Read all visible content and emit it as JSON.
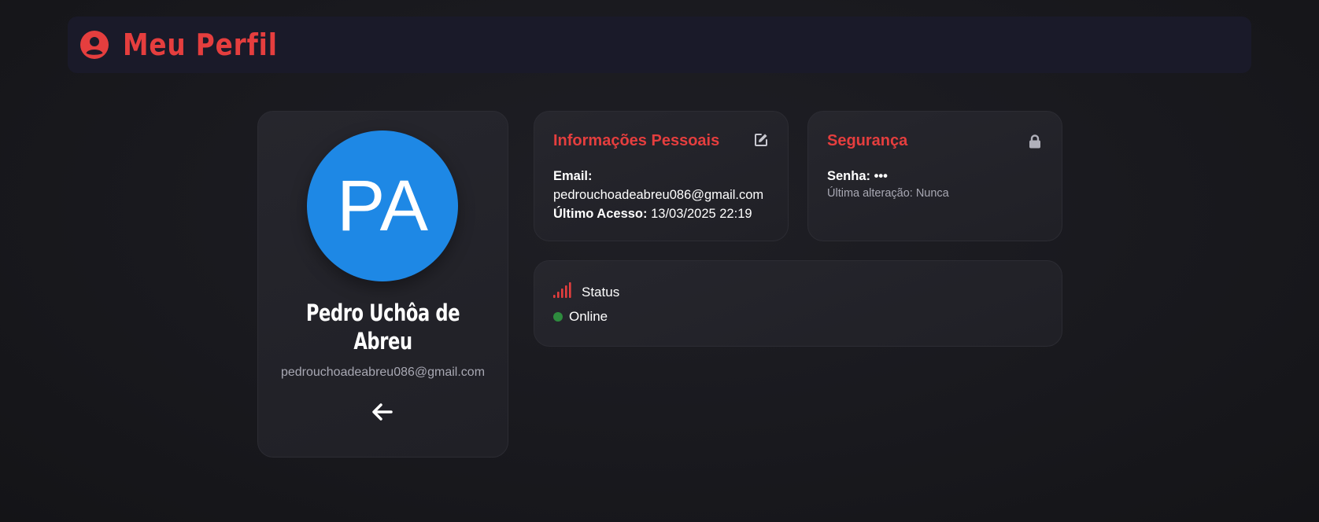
{
  "header": {
    "title": "Meu Perfil",
    "icon": "user-circle-icon"
  },
  "profile": {
    "initials": "PA",
    "name": "Pedro Uchôa de Abreu",
    "email": "pedrouchoadeabreu086@gmail.com",
    "back_icon": "arrow-left-icon",
    "avatar_color": "#1e88e5"
  },
  "personal_info": {
    "title": "Informações Pessoais",
    "edit_icon": "edit-icon",
    "email_label": "Email:",
    "email_value": "pedrouchoadeabreu086@gmail.com",
    "last_access_label": "Último Acesso:",
    "last_access_value": "13/03/2025 22:19"
  },
  "security": {
    "title": "Segurança",
    "lock_icon": "lock-icon",
    "password_label": "Senha:",
    "password_value": "•••",
    "last_change": "Última alteração: Nunca"
  },
  "status": {
    "title": "Status",
    "icon": "signal-bars-icon",
    "value": "Online",
    "indicator_color": "#2e8b3e"
  },
  "colors": {
    "accent": "#e53e3e",
    "header_bg": "#1a1a29",
    "card_bg": "#23232a"
  }
}
